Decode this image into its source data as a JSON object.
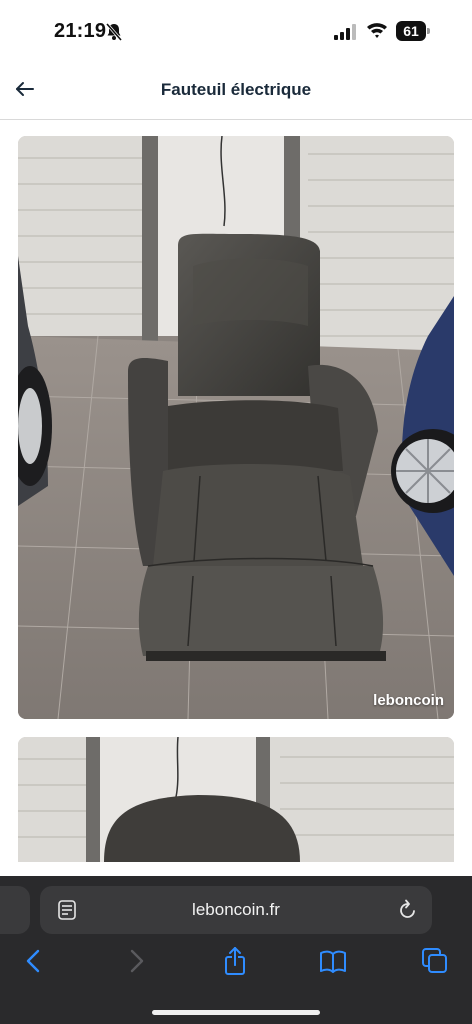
{
  "status_bar": {
    "time": "21:19",
    "battery_level": "61"
  },
  "header": {
    "title": "Fauteuil électrique"
  },
  "listing": {
    "photo_watermark": "leboncoin"
  },
  "browser": {
    "url": "leboncoin.fr"
  },
  "colors": {
    "accent_blue": "#2f8cff",
    "browser_bg": "#2a2a2c",
    "url_bar_bg": "#3a3a3c"
  }
}
